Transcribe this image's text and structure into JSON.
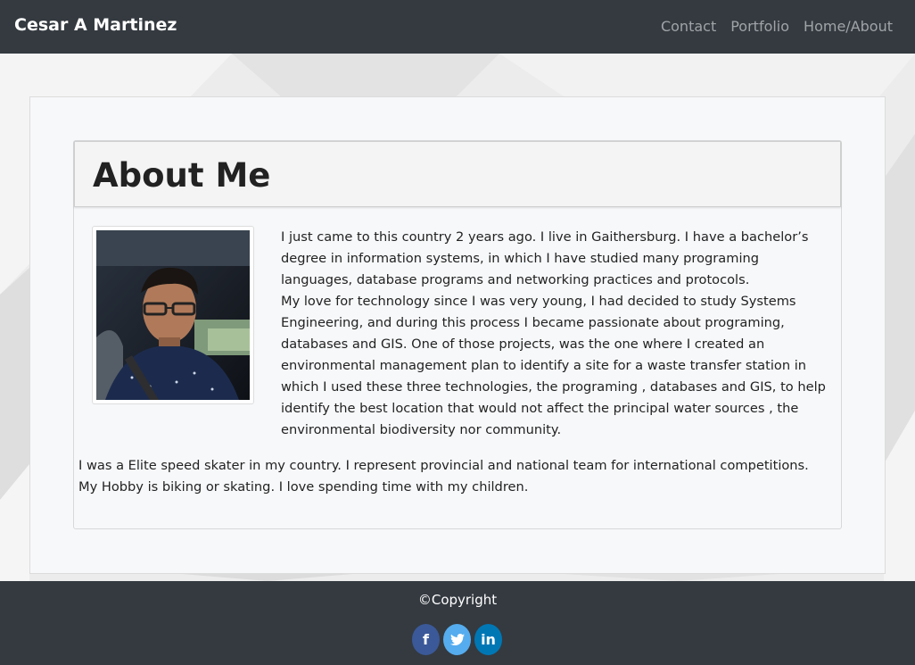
{
  "navbar": {
    "brand": "Cesar A Martinez",
    "links": [
      "Contact",
      "Portfolio",
      "Home/About"
    ]
  },
  "about": {
    "title": "About Me",
    "paragraph_1": "I just came to this country 2 years ago. I live in Gaithersburg. I have a bachelor’s degree in information systems, in which I have studied many programing languages, database programs and networking practices and protocols.",
    "paragraph_2": "My love for technology since I was very young, I had decided to study Systems Engineering, and during this process I became passionate about programing, databases and GIS. One of those projects, was the one where I created an environmental management plan to identify a site for a waste transfer station in which I used these three technologies, the programing , databases and GIS, to help identify the best location that would not affect the principal water sources , the environmental biodiversity nor community.",
    "paragraph_3": "I was a Elite speed skater in my country. I represent provincial and national team for international competitions. My Hobby is biking or skating. I love spending time with my children."
  },
  "footer": {
    "copyright": "©Copyright",
    "socials": [
      {
        "icon": "facebook-icon",
        "glyph": "f",
        "color": "#3b5998"
      },
      {
        "icon": "twitter-icon",
        "glyph": "t",
        "color": "#55acee"
      },
      {
        "icon": "linkedin-icon",
        "glyph": "in",
        "color": "#0077b5"
      }
    ]
  },
  "colors": {
    "navbar_bg": "#343a40",
    "nav_link": "#a0a4a8",
    "jumbotron_bg": "#f7f8fa"
  }
}
